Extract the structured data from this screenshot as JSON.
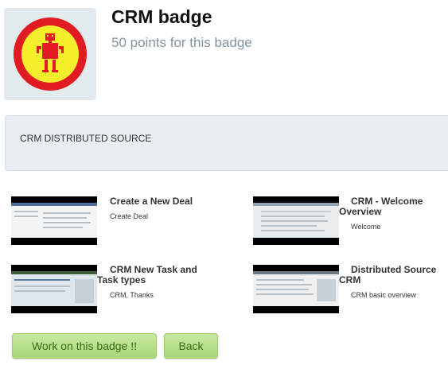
{
  "badge": {
    "title": "CRM badge",
    "points_text": "50 points for this badge",
    "icon": "robot-badge-icon",
    "colors": {
      "ring": "#e21b23",
      "fill": "#f5ee2b",
      "box": "#e3eaee"
    }
  },
  "source": {
    "label": "CRM DISTRIBUTED SOURCE"
  },
  "videos": [
    {
      "title": "Create a New Deal",
      "description": "Create Deal"
    },
    {
      "title": "CRM - Welcome Overview",
      "description": "Welcome"
    },
    {
      "title": "CRM New Task and Task types",
      "description": "CRM, Thanks"
    },
    {
      "title": "Distributed Source CRM",
      "description": "CRM basic overview"
    }
  ],
  "actions": {
    "work_label": "Work on this badge !!",
    "back_label": "Back",
    "accent": "#a8d878"
  }
}
